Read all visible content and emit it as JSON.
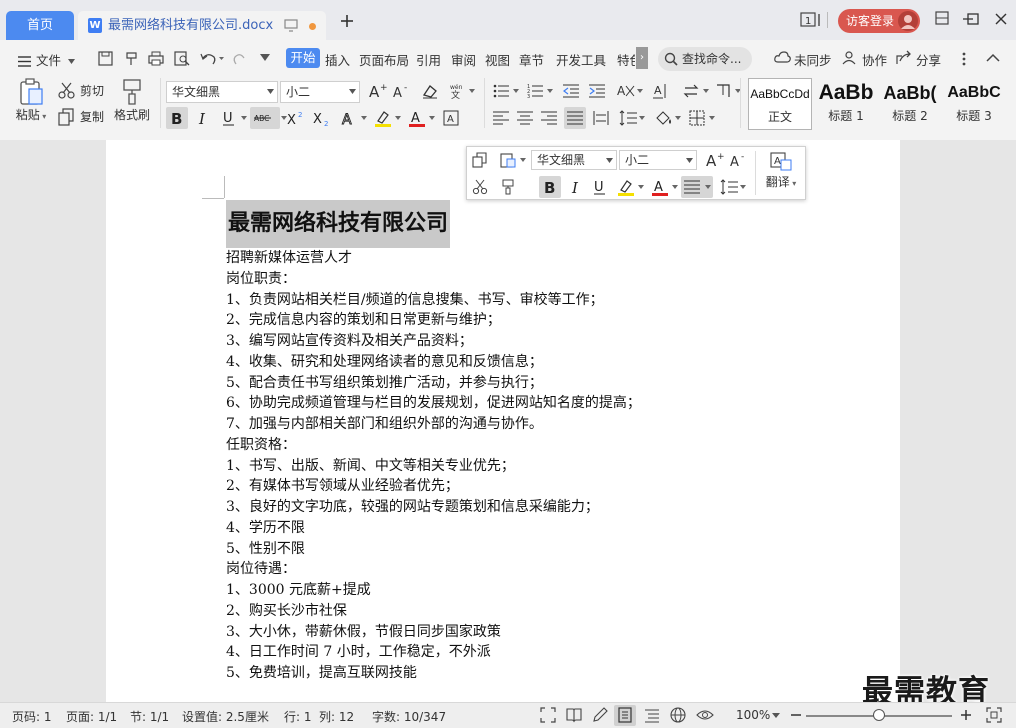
{
  "titlebar": {
    "home_tab": "首页",
    "doc_tab": "最需网络科技有限公司.docx",
    "badge": "1",
    "login": "访客登录"
  },
  "menu": {
    "file": "文件",
    "tabs": [
      "开始",
      "插入",
      "页面布局",
      "引用",
      "审阅",
      "视图",
      "章节",
      "开发工具",
      "特色"
    ],
    "search": "查找命令...",
    "sync": "未同步",
    "collab": "协作",
    "share": "分享"
  },
  "ribbon": {
    "paste": "粘贴",
    "cut": "剪切",
    "copy": "复制",
    "format_painter": "格式刷",
    "font": "华文细黑",
    "size": "小二",
    "styles": [
      {
        "preview": "AaBbCcDd",
        "name": "正文"
      },
      {
        "preview": "AaBb",
        "name": "标题 1"
      },
      {
        "preview": "AaBb(",
        "name": "标题 2"
      },
      {
        "preview": "AaBbC",
        "name": "标题 3"
      }
    ]
  },
  "minibar": {
    "font": "华文细黑",
    "size": "小二",
    "translate": "翻译"
  },
  "document": {
    "title": "最需网络科技有限公司",
    "lines": [
      "招聘新媒体运营人才",
      "岗位职责：",
      "1、负责网站相关栏目/频道的信息搜集、书写、审校等工作；",
      "2、完成信息内容的策划和日常更新与维护；",
      "3、编写网站宣传资料及相关产品资料；",
      "4、收集、研究和处理网络读者的意见和反馈信息；",
      "5、配合责任书写组织策划推广活动，并参与执行；",
      "6、协助完成频道管理与栏目的发展规划，促进网站知名度的提高；",
      "7、加强与内部相关部门和组织外部的沟通与协作。",
      "任职资格：",
      "1、书写、出版、新闻、中文等相关专业优先；",
      "2、有媒体书写领域从业经验者优先；",
      "3、良好的文字功底，较强的网站专题策划和信息采编能力；",
      "4、学历不限",
      "5、性别不限",
      "岗位待遇：",
      "1、3000 元底薪+提成",
      "2、购买长沙市社保",
      "3、大小休，带薪休假，节假日同步国家政策",
      "4、日工作时间 7 小时，工作稳定，不外派",
      "5、免费培训，提高互联网技能"
    ]
  },
  "status": {
    "page_no": "页码: 1",
    "pages": "页面: 1/1",
    "section": "节: 1/1",
    "setting": "设置值: 2.5厘米",
    "row": "行: 1",
    "col": "列: 12",
    "words": "字数: 10/347",
    "zoom": "100%",
    "zoom_level": 0.5
  },
  "watermark": "最需教育",
  "colors": {
    "accent": "#4c8af0",
    "login_bg": "#d9574f",
    "highlight": "#c9c9c9"
  }
}
